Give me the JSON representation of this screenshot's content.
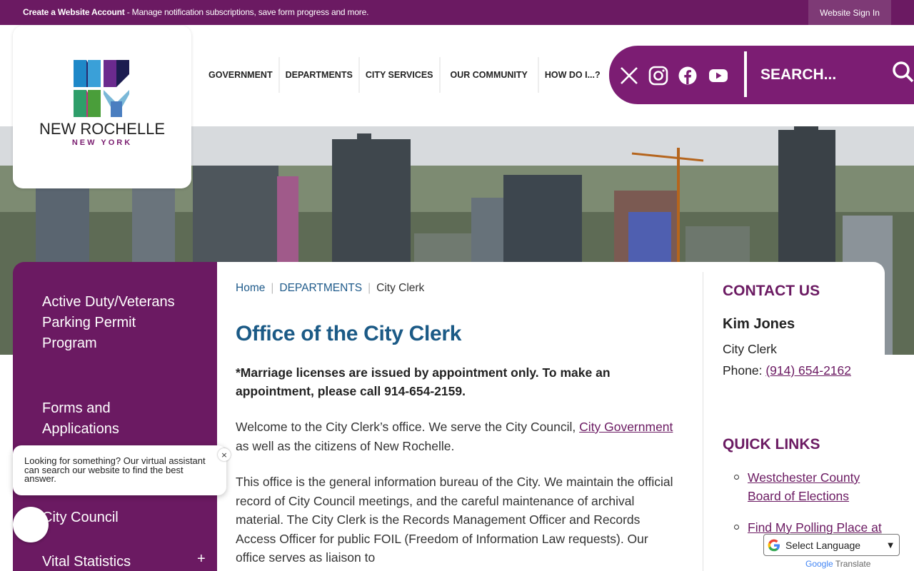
{
  "topbar": {
    "create_account": "Create a Website Account",
    "create_account_desc": " - Manage notification subscriptions, save form progress and more.",
    "sign_in": "Website Sign In"
  },
  "logo": {
    "name": "NEW ROCHELLE",
    "sub": "NEW YORK",
    "mark": "NR NY"
  },
  "nav": {
    "items": [
      "GOVERNMENT",
      "DEPARTMENTS",
      "CITY SERVICES",
      "OUR COMMUNITY",
      "HOW DO I...?"
    ]
  },
  "utility": {
    "social": [
      "x-icon",
      "instagram-icon",
      "facebook-icon",
      "youtube-icon"
    ],
    "search_placeholder": "SEARCH..."
  },
  "sidebar": {
    "items": [
      {
        "label": "Active Duty/Veterans Parking Permit Program"
      },
      {
        "label": "Forms and Applications"
      },
      {
        "label": "City Council"
      },
      {
        "label": "Vital Statistics",
        "expand": "+"
      }
    ]
  },
  "breadcrumb": {
    "home": "Home",
    "section": "DEPARTMENTS",
    "current": "City Clerk",
    "sep": "|"
  },
  "main": {
    "title": "Office of the City Clerk",
    "notice": "*Marriage licenses are issued by appointment only. To make an appointment, please call 914-654-2159.",
    "p1_before": "Welcome to the City Clerk’s office. We serve the City Council, ",
    "p1_link": "City Government ",
    "p1_after": "as well as the citizens of New Rochelle.",
    "p2": "This office is the general information bureau of the City. We maintain the official record of City Council meetings, and the careful maintenance of archival material. The City Clerk is the Records Management Officer and Records Access Officer for public FOIL (Freedom of Information Law requests). Our office serves as liaison to"
  },
  "contact": {
    "heading": "CONTACT US",
    "name": "Kim Jones",
    "role": "City Clerk",
    "phone_label": "Phone: ",
    "phone": "(914) 654-2162"
  },
  "quick_links": {
    "heading": "QUICK LINKS",
    "items": [
      "Westchester County Board of Elections",
      "Find My Polling Place at"
    ]
  },
  "chat": {
    "message": "Looking for something? Our virtual assistant can search our website to find the best answer.",
    "close": "×"
  },
  "translate": {
    "label": "Select Language",
    "powered_google": "Google",
    "powered_translate": " Translate"
  },
  "colors": {
    "brand_purple": "#6b1a62",
    "accent_blue": "#1b5a86"
  }
}
